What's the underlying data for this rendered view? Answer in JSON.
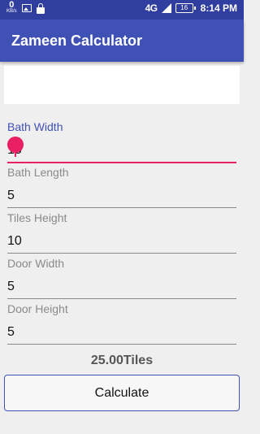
{
  "status_bar": {
    "data_speed": "0",
    "data_unit": "KB/s",
    "network": "4G",
    "battery": "16",
    "time": "8:14 PM"
  },
  "app_bar": {
    "title": "Zameen Calculator"
  },
  "fields": [
    {
      "label": "Bath Width",
      "value": "15"
    },
    {
      "label": "Bath Length",
      "value": "5"
    },
    {
      "label": "Tiles Height",
      "value": "10"
    },
    {
      "label": "Door Width",
      "value": "5"
    },
    {
      "label": "Door Height",
      "value": "5"
    }
  ],
  "result": "25.00Tiles",
  "calculate_button": "Calculate"
}
